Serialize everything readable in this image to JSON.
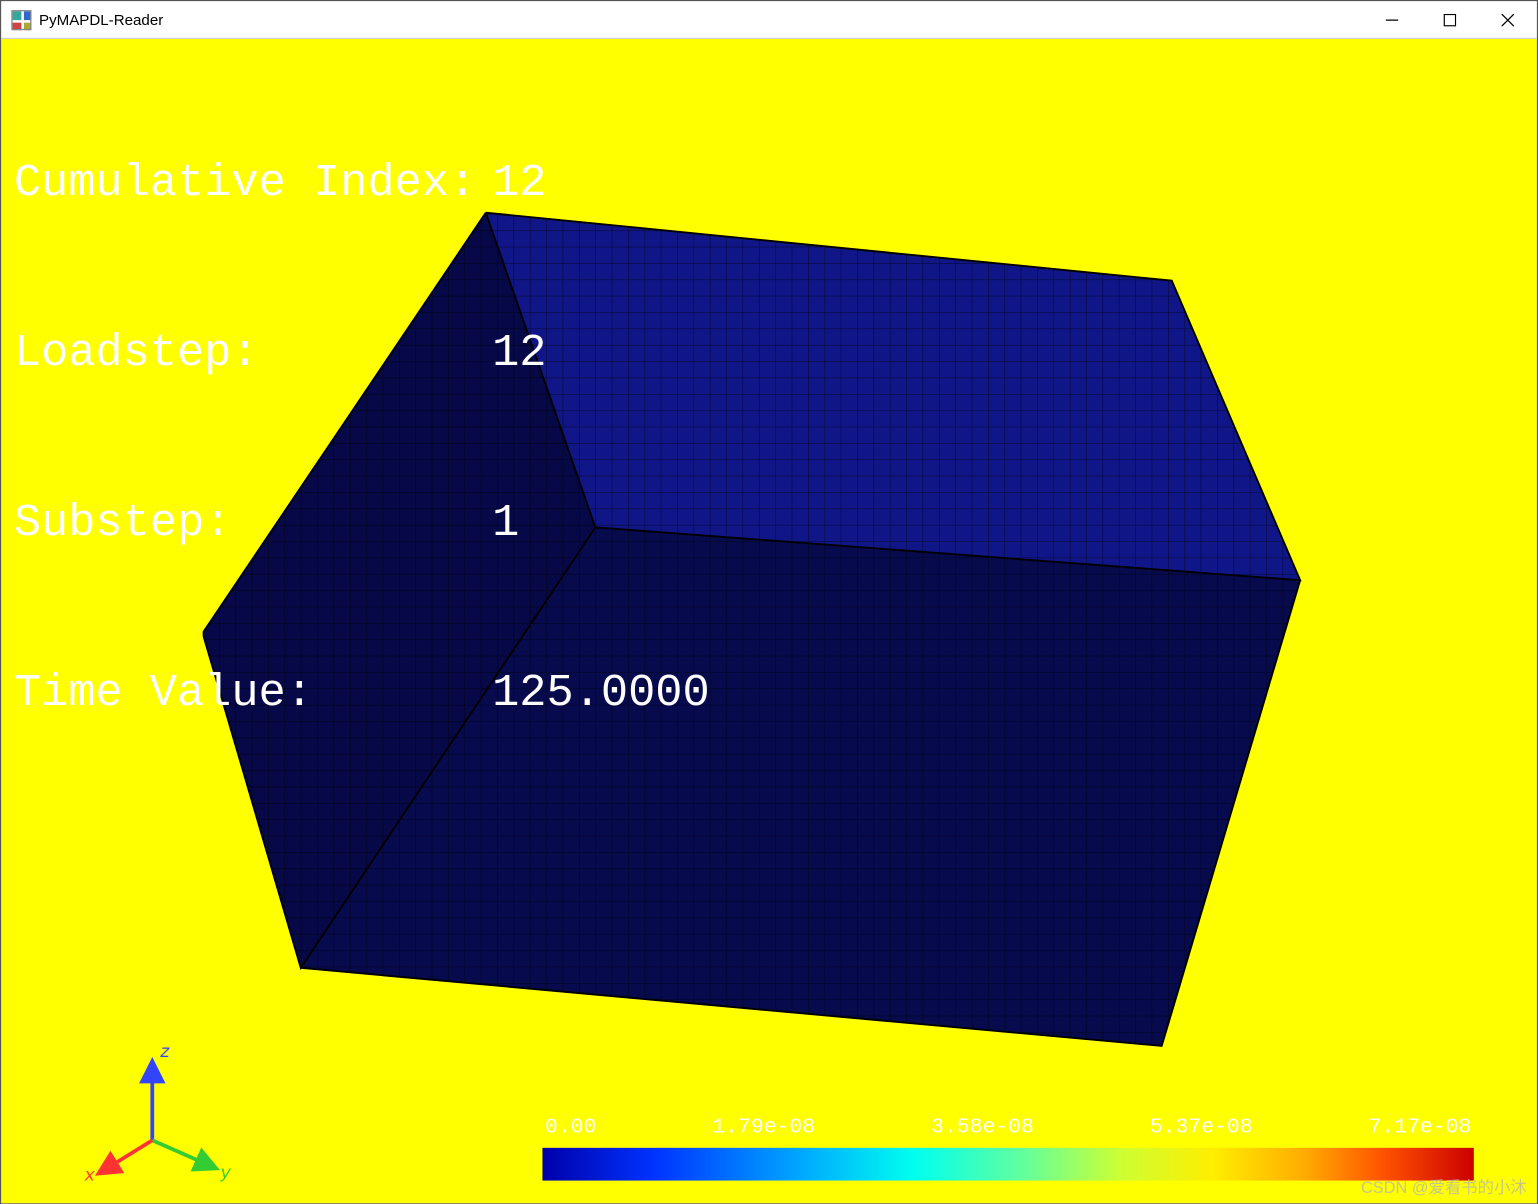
{
  "window": {
    "title": "PyMAPDL-Reader"
  },
  "overlay": {
    "rows": [
      {
        "label": "Cumulative Index:",
        "value": "12"
      },
      {
        "label": "Loadstep:",
        "value": "12"
      },
      {
        "label": "Substep:",
        "value": "1"
      },
      {
        "label": "Time Value:",
        "value": "125.0000"
      }
    ]
  },
  "axes": {
    "x": "x",
    "y": "y",
    "z": "z",
    "x_color": "#ff3333",
    "y_color": "#33cc33",
    "z_color": "#3344ff"
  },
  "colorbar": {
    "ticks": [
      "0.00",
      "1.79e-08",
      "3.58e-08",
      "5.37e-08",
      "7.17e-08"
    ]
  },
  "mesh": {
    "fill_top": "#101688",
    "fill_front": "#070a4d",
    "fill_side": "#060848"
  },
  "watermark": "CSDN @爱看书的小沐",
  "chart_data": {
    "type": "heatmap",
    "title": "",
    "colorbar_range": [
      0.0,
      7.17e-08
    ],
    "colorbar_ticks": [
      0.0,
      1.79e-08,
      3.58e-08,
      5.37e-08,
      7.17e-08
    ],
    "description": "3D FE mesh block colored by scalar result; visible faces are uniformly near the colorbar minimum (≈0)."
  }
}
